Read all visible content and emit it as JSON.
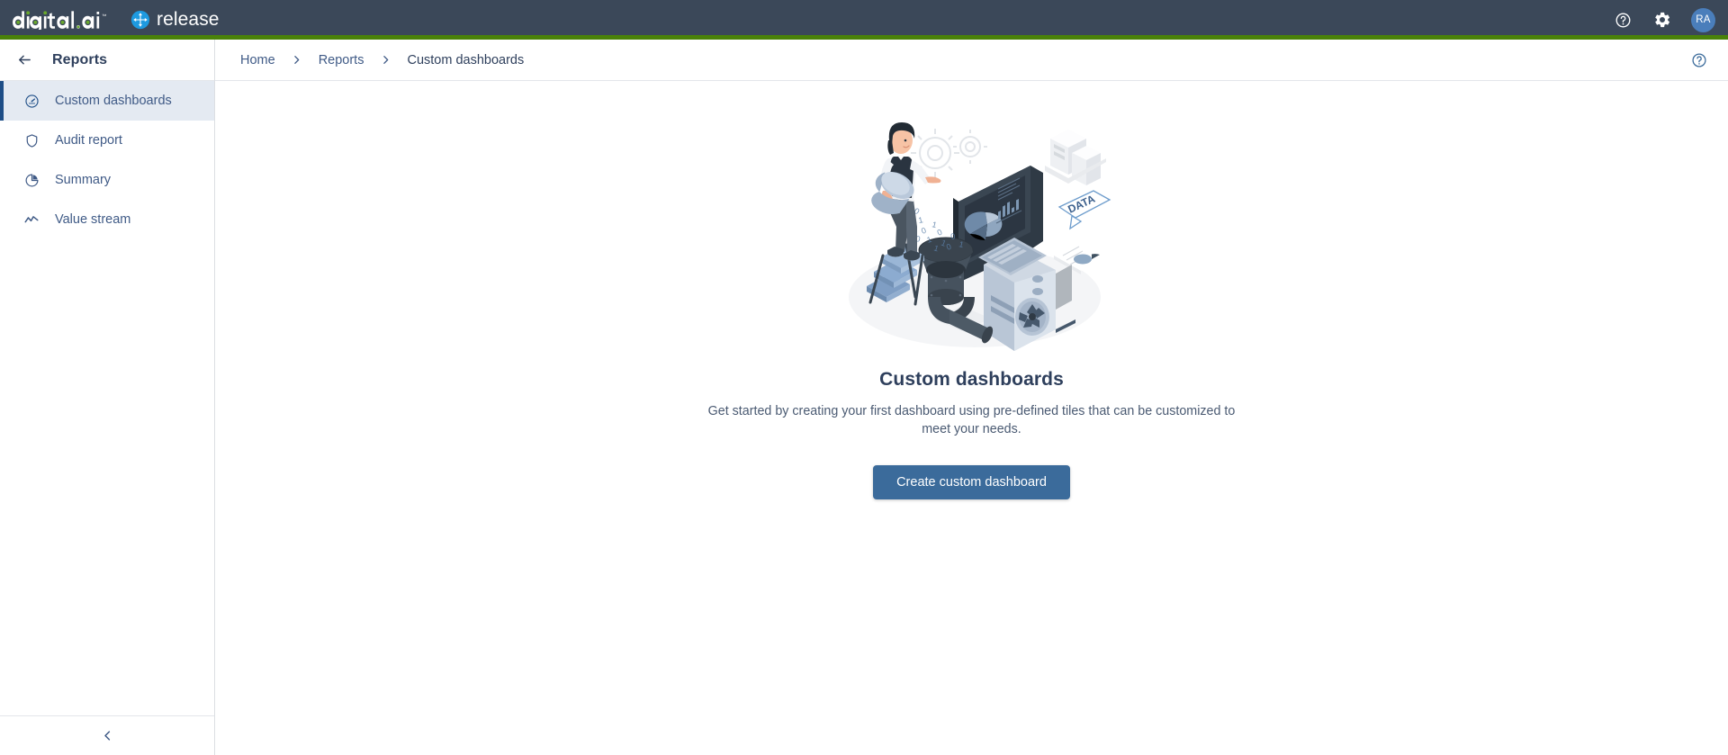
{
  "topbar": {
    "brand_primary": "digital.ai",
    "brand_product": "release",
    "trademark": "™",
    "help_icon": "help-circle-icon",
    "settings_icon": "gear-icon",
    "avatar_initials": "RA",
    "accent_color": "#4a8209",
    "background_color": "#3b4859",
    "avatar_color": "#4a7ebb"
  },
  "sidebar": {
    "title": "Reports",
    "back_icon": "arrow-left-icon",
    "collapse_icon": "chevron-left-icon",
    "active_color": "#1e4e87",
    "active_bg": "#e4eaf2",
    "items": [
      {
        "label": "Custom dashboards",
        "icon": "gauge-icon",
        "active": true
      },
      {
        "label": "Audit report",
        "icon": "shield-icon",
        "active": false
      },
      {
        "label": "Summary",
        "icon": "pie-chart-icon",
        "active": false
      },
      {
        "label": "Value stream",
        "icon": "trending-line-icon",
        "active": false
      }
    ]
  },
  "breadcrumb": {
    "items": [
      {
        "label": "Home"
      },
      {
        "label": "Reports"
      },
      {
        "label": "Custom dashboards"
      }
    ],
    "separator_icon": "chevron-right-icon",
    "help_icon": "help-circle-icon"
  },
  "main": {
    "illustration_name": "data-dashboard-illustration",
    "title": "Custom dashboards",
    "description": "Get started by creating your first dashboard using pre-defined tiles that can be customized to meet your needs.",
    "cta_label": "Create custom dashboard",
    "cta_color": "#3b6b9b",
    "illustration_label": "DATA"
  }
}
